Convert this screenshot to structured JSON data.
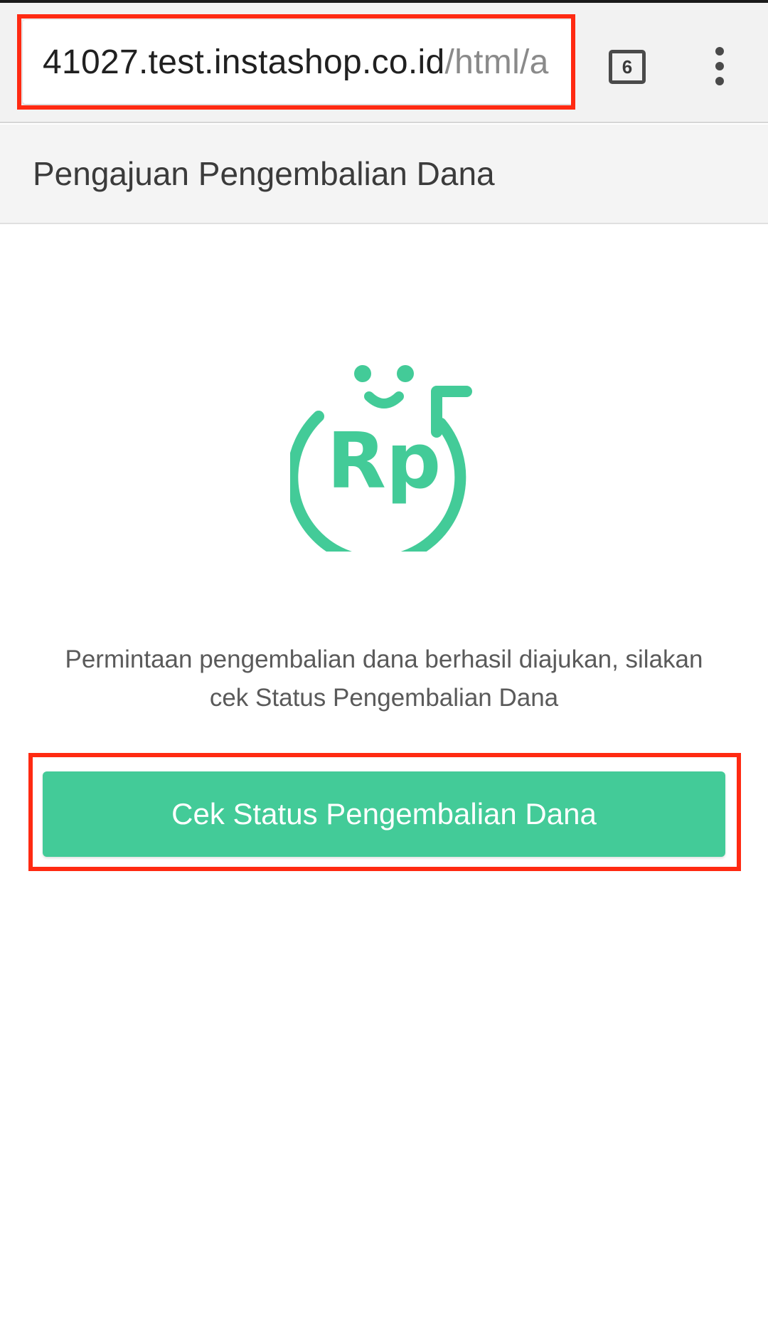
{
  "browser": {
    "url_host": "41027.test.instashop.co.id",
    "url_path": "/html/a",
    "tab_count": "6",
    "menu_icon": "more-vert-icon",
    "highlight_color": "#ff2a12"
  },
  "header": {
    "title": "Pengajuan Pengembalian Dana"
  },
  "content": {
    "icon": "refund-rupiah-icon",
    "icon_text": "Rp",
    "accent_color": "#43cb98",
    "message": "Permintaan pengembalian dana berhasil diajukan, silakan cek Status Pengembalian Dana",
    "button_label": "Cek Status Pengembalian Dana"
  }
}
